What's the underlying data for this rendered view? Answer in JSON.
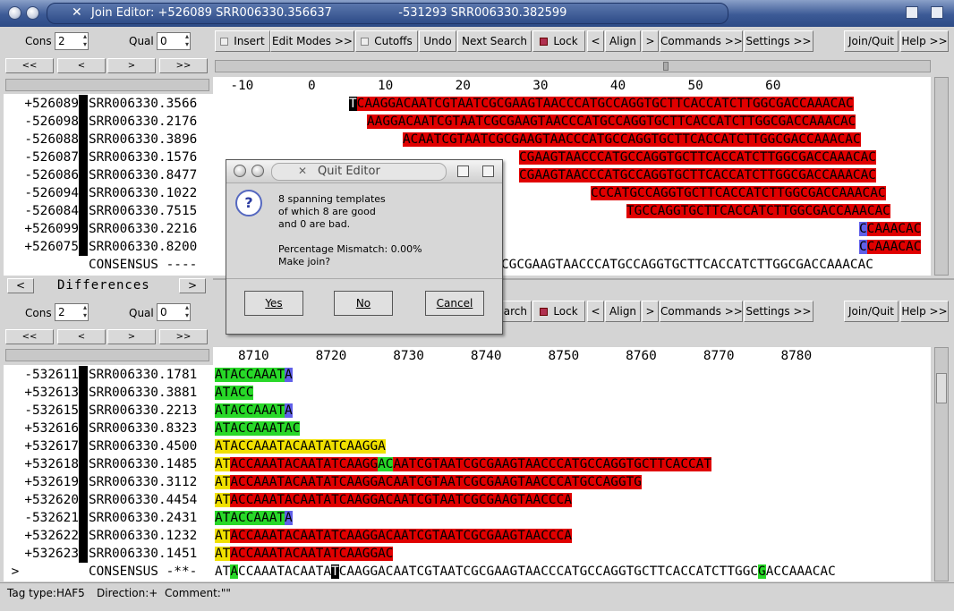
{
  "window": {
    "title": "Join Editor: +526089 SRR006330.356637                  -531293 SRR006330.382599"
  },
  "toolbar_top": {
    "cons_label": "Cons",
    "cons_value": "2",
    "qual_label": "Qual",
    "qual_value": "0",
    "insert": "Insert",
    "edit_modes": "Edit Modes >>",
    "cutoffs": "Cutoffs",
    "undo": "Undo",
    "next_search": "Next Search",
    "lock": "Lock",
    "lt": "<",
    "align": "Align",
    "gt": ">",
    "commands": "Commands >>",
    "settings": "Settings >>",
    "join_quit": "Join/Quit",
    "help": "Help >>"
  },
  "toolbar_bottom": {
    "cons_label": "Cons",
    "cons_value": "2",
    "qual_label": "Qual",
    "qual_value": "0",
    "search_partial": "arch",
    "lock": "Lock",
    "lt": "<",
    "align": "Align",
    "gt": ">",
    "commands": "Commands >>",
    "settings": "Settings >>",
    "join_quit": "Join/Quit",
    "help": "Help >>"
  },
  "nav": {
    "first": "<<",
    "prev": "<",
    "next": ">",
    "last": ">>"
  },
  "top": {
    "ruler": "  -10       0        10        20        30        40        50        60",
    "rows": [
      {
        "dir": "+526089",
        "name": "SRR006330.3566"
      },
      {
        "dir": "-526098",
        "name": "SRR006330.2176"
      },
      {
        "dir": "-526088",
        "name": "SRR006330.3896"
      },
      {
        "dir": "-526087",
        "name": "SRR006330.1576"
      },
      {
        "dir": "-526086",
        "name": "SRR006330.8477"
      },
      {
        "dir": "-526094",
        "name": "SRR006330.1022"
      },
      {
        "dir": "-526084",
        "name": "SRR006330.7515"
      },
      {
        "dir": "+526099",
        "name": "SRR006330.2216"
      },
      {
        "dir": "+526075",
        "name": "SRR006330.8200"
      }
    ],
    "seqs": [
      "TCAAGGACAATCGTAATCGCGAAGTAACCCATGCCAGGTGCTTCACCATCTTGGCGACCAAACAC",
      "AAGGACAATCGTAATCGCGAAGTAACCCATGCCAGGTGCTTCACCATCTTGGCGACCAAACAC",
      "ACAATCGTAATCGCGAAGTAACCCATGCCAGGTGCTTCACCATCTTGGCGACCAAACAC",
      "CGAAGTAACCCATGCCAGGTGCTTCACCATCTTGGCGACCAAACAC",
      "CGAAGTAACCCATGCCAGGTGCTTCACCATCTTGGCGACCAAACAC",
      "CCCATGCCAGGTGCTTCACCATCTTGGCGACCAAACAC",
      "TGCCAGGTGCTTCACCATCTTGGCGACCAAACAC",
      "CCAAACAC",
      "CCAAACAC"
    ],
    "consensus_label": "CONSENSUS ----",
    "consensus_seq": "CGCGAAGTAACCCATGCCAGGTGCTTCACCATCTTGGCGACCAAACAC"
  },
  "differences": {
    "label": "Differences",
    "lt": "<",
    "gt": ">"
  },
  "bottom": {
    "ruler": "   8710      8720      8730      8740      8750      8760      8770      8780",
    "rows": [
      {
        "dir": "-532611",
        "name": "SRR006330.1781"
      },
      {
        "dir": "+532613",
        "name": "SRR006330.3881"
      },
      {
        "dir": "-532615",
        "name": "SRR006330.2213"
      },
      {
        "dir": "+532616",
        "name": "SRR006330.8323"
      },
      {
        "dir": "+532617",
        "name": "SRR006330.4500"
      },
      {
        "dir": "+532618",
        "name": "SRR006330.1485"
      },
      {
        "dir": "+532619",
        "name": "SRR006330.3112"
      },
      {
        "dir": "+532620",
        "name": "SRR006330.4454"
      },
      {
        "dir": "-532621",
        "name": "SRR006330.2431"
      },
      {
        "dir": "+532622",
        "name": "SRR006330.1232"
      },
      {
        "dir": "+532623",
        "name": "SRR006330.1451"
      }
    ],
    "seqs": [
      "ATACCAAATA",
      "ATACC",
      "ATACCAAATA",
      "ATACCAAATAC",
      "ATACCAAATACAATATCAAGGA",
      "ATACCAAATACAATATCAAGGACAATCGTAATCGCGAAGTAACCCATGCCAGGTGCTTCACCAT",
      "ATACCAAATACAATATCAAGGACAATCGTAATCGCGAAGTAACCCATGCCAGGTG",
      "ATACCAAATACAATATCAAGGACAATCGTAATCGCGAAGTAACCCA",
      "ATACCAAATA",
      "ATACCAAATACAATATCAAGGACAATCGTAATCGCGAAGTAACCCA",
      "ATACCAAATACAATATCAAGGAC"
    ],
    "consensus_prefix": " >",
    "consensus_label": "CONSENSUS -**-",
    "consensus_seq": "ATACCAAATACAATATCAAGGACAATCGTAATCGCGAAGTAACCCATGCCAGGTGCTTCACCATCTTGGCGACCAAACAC"
  },
  "dialog": {
    "title": "Quit Editor",
    "line1": "8 spanning templates",
    "line2": "of which 8 are good",
    "line3": "and 0 are bad.",
    "line4": "Percentage Mismatch:  0.00%",
    "line5": "Make join?",
    "yes": "Yes",
    "no": "No",
    "cancel": "Cancel"
  },
  "status": {
    "tag_type": "Tag type:HAF5",
    "direction": "Direction:+",
    "comment": "Comment:\"\""
  },
  "colors": {
    "red": "#e00000",
    "yellow": "#f0e000",
    "green": "#28d828",
    "blue": "#6060e8"
  }
}
